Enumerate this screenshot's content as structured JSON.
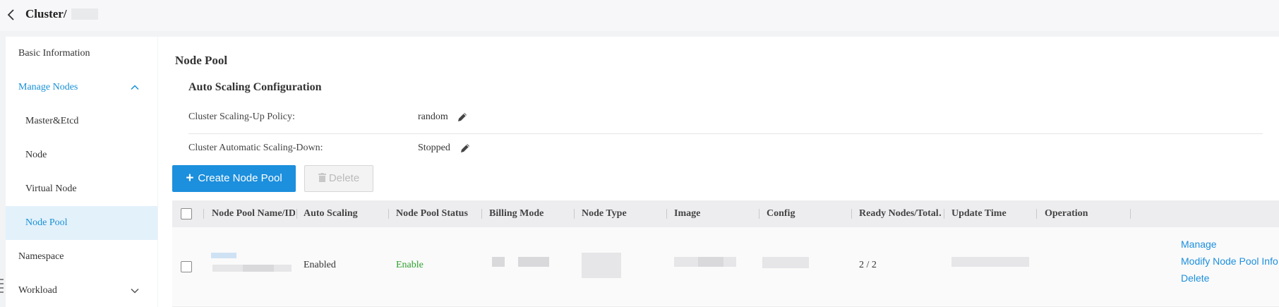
{
  "header": {
    "breadcrumb": "Cluster/"
  },
  "sidebar": {
    "items": [
      {
        "label": "Basic Information"
      },
      {
        "label": "Manage Nodes"
      },
      {
        "label": "Master&Etcd"
      },
      {
        "label": "Node"
      },
      {
        "label": "Virtual Node"
      },
      {
        "label": "Node Pool"
      },
      {
        "label": "Namespace"
      },
      {
        "label": "Workload"
      }
    ],
    "active_item": "Node Pool"
  },
  "main": {
    "title": "Node Pool",
    "autoscaling": {
      "title": "Auto Scaling Configuration",
      "scale_up_label": "Cluster Scaling-Up Policy:",
      "scale_up_value": "random",
      "scale_down_label": "Cluster Automatic Scaling-Down:",
      "scale_down_value": "Stopped"
    },
    "buttons": {
      "create": "Create Node Pool",
      "delete": "Delete"
    }
  },
  "table": {
    "columns": [
      "Node Pool Name/ID",
      "Auto Scaling",
      "Node Pool Status",
      "Billing Mode",
      "Node Type",
      "Image",
      "Config",
      "Ready Nodes/Total…",
      "Update Time",
      "Operation"
    ],
    "rows": [
      {
        "auto_scaling": "Enabled",
        "status": "Enable",
        "ready_nodes": "2 / 2",
        "operations": [
          "Manage",
          "Modify Node Pool Info",
          "Delete"
        ]
      }
    ]
  },
  "colors": {
    "accent": "#1c8fdd",
    "active_bg": "#e3f1fb",
    "status_green": "#2ea02e"
  },
  "icons": [
    "chevron-left-icon",
    "chevron-up-icon",
    "chevron-down-icon",
    "pencil-icon",
    "plus-icon",
    "trash-icon",
    "drag-handle-icon"
  ]
}
